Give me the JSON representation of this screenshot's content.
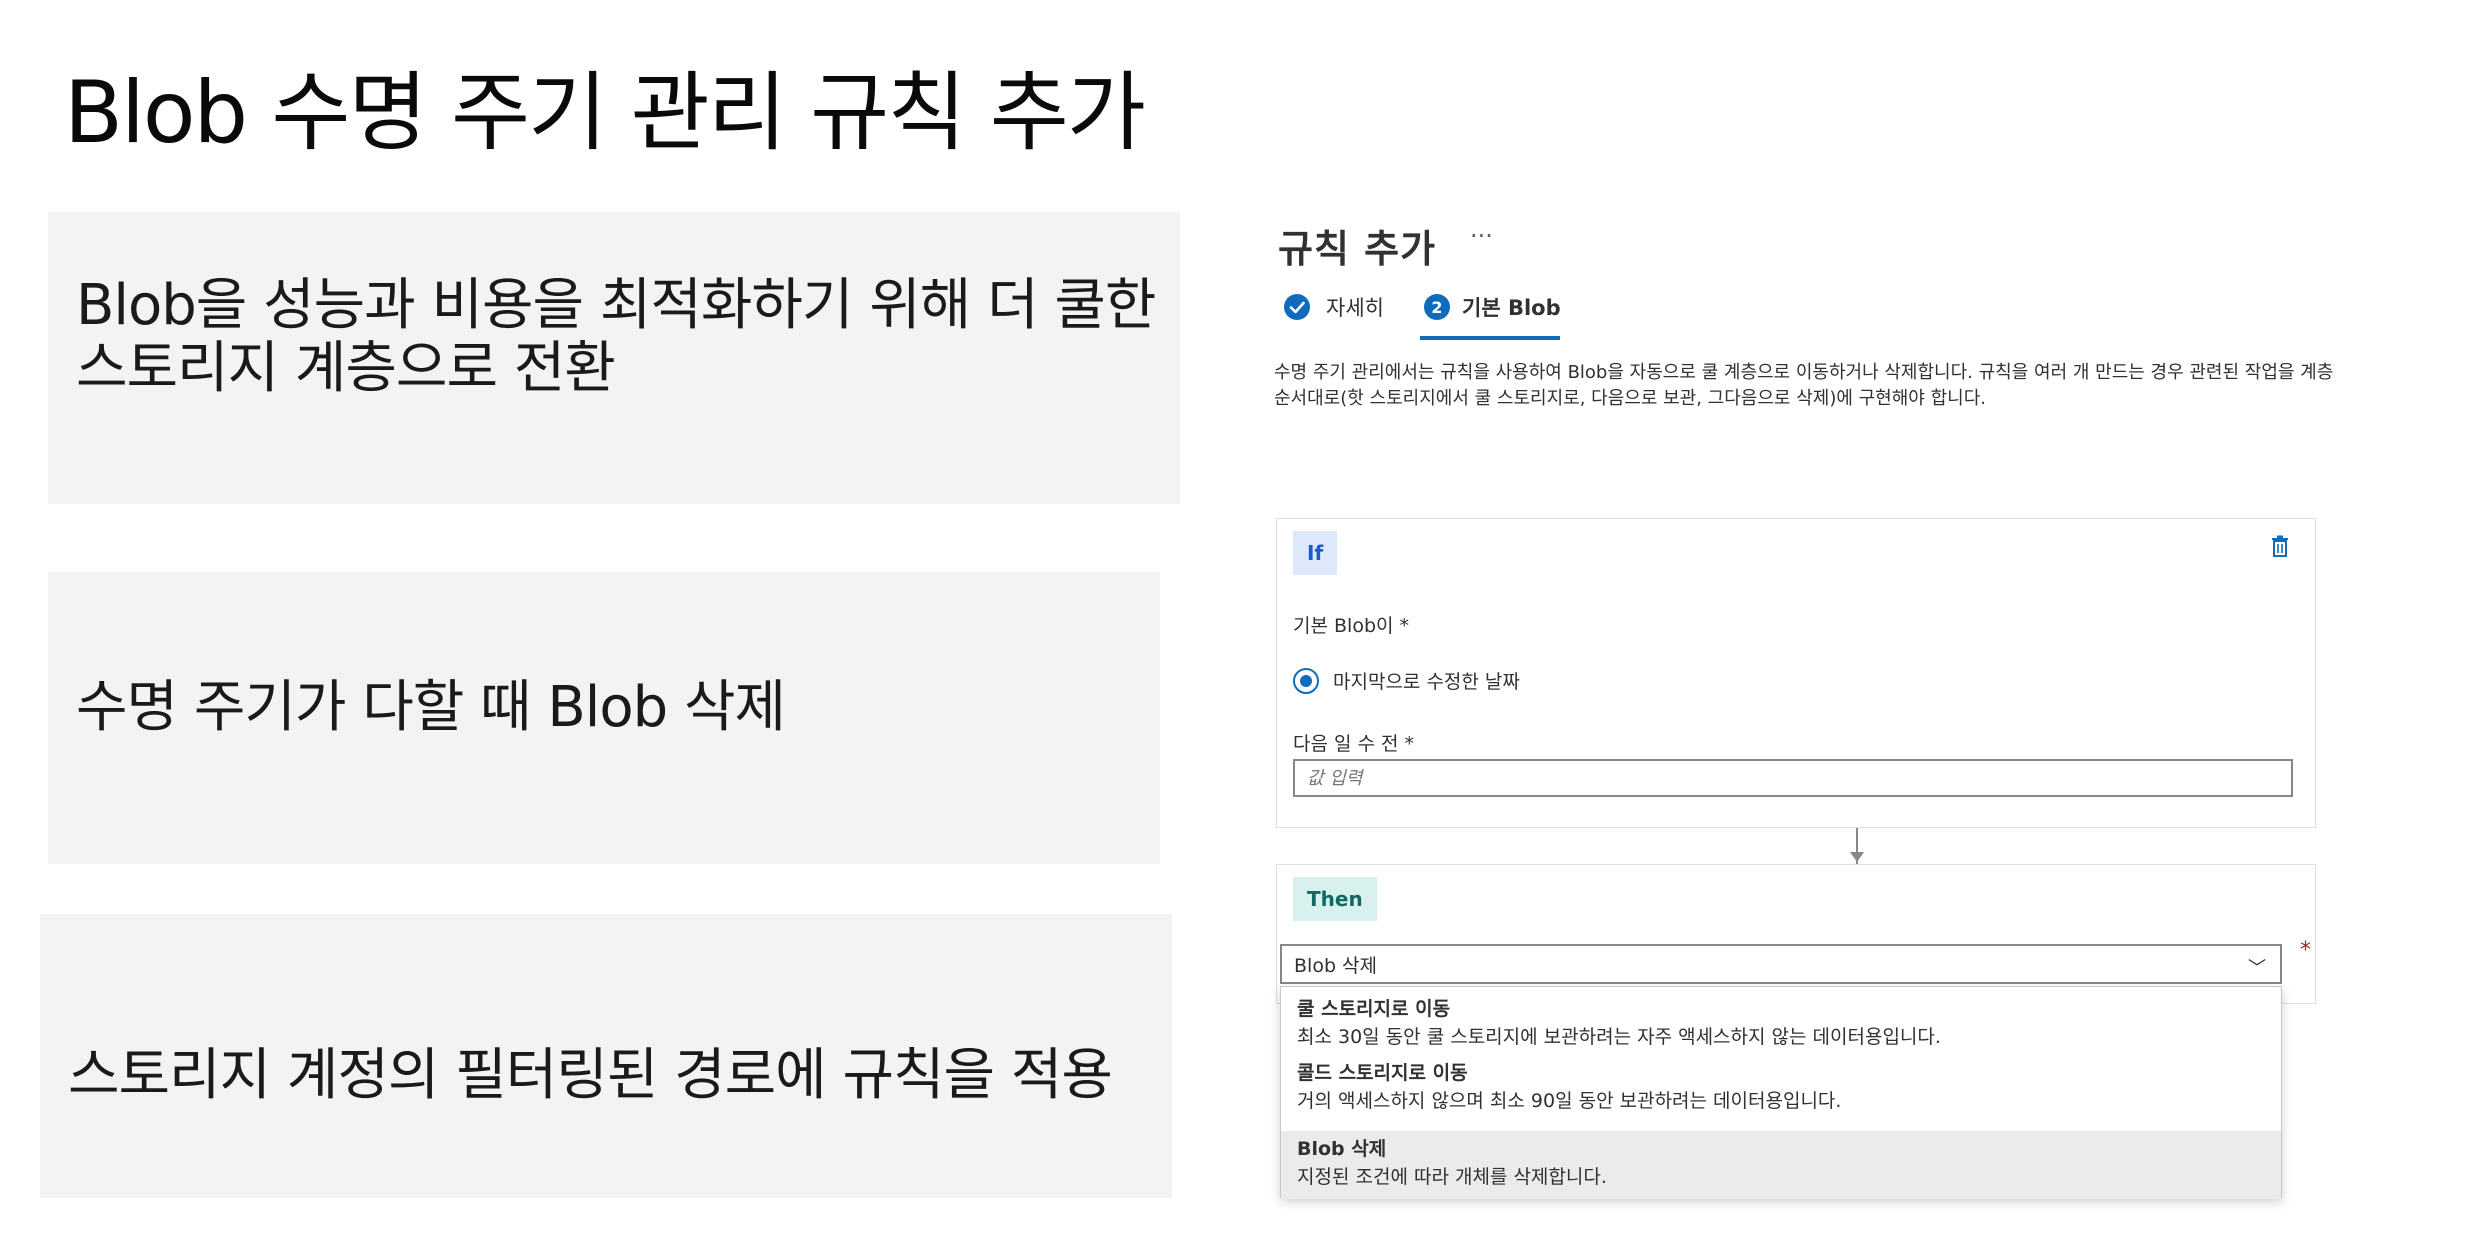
{
  "slide": {
    "title": "Blob 수명 주기 관리 규칙 추가",
    "points": [
      {
        "line1": "Blob을 성능과 비용을 최적화하기 위해 더 쿨한",
        "line2": "스토리지 계층으로 전환"
      },
      {
        "line1": "수명 주기가 다할 때 Blob 삭제"
      },
      {
        "line1": "스토리지 계정의 필터링된 경로에 규칙을 적용"
      }
    ]
  },
  "panel": {
    "title": "규칙 추가",
    "more": "···",
    "steps": [
      {
        "label": "자세히",
        "state": "done"
      },
      {
        "number": "2",
        "label": "기본 Blob",
        "state": "active"
      }
    ],
    "description": "수명 주기 관리에서는 규칙을 사용하여 Blob을 자동으로 쿨 계층으로 이동하거나 삭제합니다. 규칙을 여러 개 만드는 경우 관련된 작업을 계층 순서대로(핫 스토리지에서 쿨 스토리지로, 다음으로 보관, 그다음으로 삭제)에 구현해야 합니다.",
    "if_card": {
      "tag": "If",
      "base_blob_label": "기본 Blob이 *",
      "radio_label": "마지막으로 수정한 날짜",
      "days_label": "다음 일 수 전 *",
      "days_placeholder": "값 입력"
    },
    "then_card": {
      "tag": "Then",
      "selected": "Blob 삭제",
      "required_mark": "*",
      "options": [
        {
          "title": "쿨 스토리지로 이동",
          "desc": "최소 30일 동안 쿨 스토리지에 보관하려는 자주 액세스하지 않는 데이터용입니다."
        },
        {
          "title": "콜드 스토리지로 이동",
          "desc": "거의 액세스하지 않으며 최소 90일 동안 보관하려는 데이터용입니다."
        },
        {
          "title": "Blob 삭제",
          "desc": "지정된 조건에 따라 개체를 삭제합니다."
        }
      ]
    }
  },
  "colors": {
    "accent": "#0f6cbd",
    "if_tag": "#dde8fb",
    "then_tag": "#d9f1ee",
    "box_bg": "#f3f3f3"
  }
}
